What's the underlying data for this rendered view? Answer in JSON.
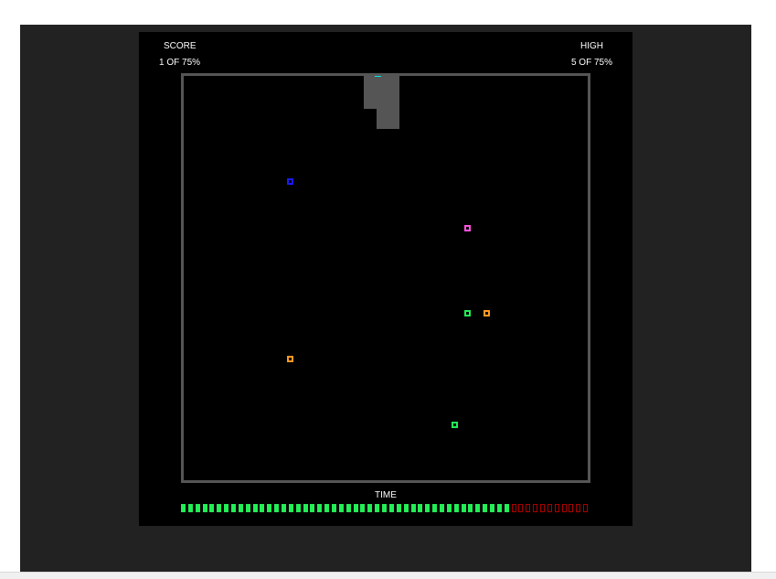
{
  "hud": {
    "score_label": "SCORE",
    "score_value": "1 OF 75%",
    "high_label": "HIGH",
    "high_value": "5 OF 75%",
    "time_label": "TIME"
  },
  "time": {
    "segments_total": 57,
    "segments_remaining": 46,
    "fill_color": "#22ee55",
    "empty_color": "#aa0000"
  },
  "colors": {
    "frame_background": "#222222",
    "game_background": "#000000",
    "border": "#555555",
    "claimed_area": "#555555",
    "hud_text": "#ffffff"
  },
  "entities": {
    "player": {
      "color": "#00e5e5",
      "icon": "player-cursor-icon"
    },
    "enemies": [
      {
        "color": "#1a1aff",
        "icon": "blue-enemy-icon"
      },
      {
        "color": "#ff55dd",
        "icon": "pink-enemy-icon"
      },
      {
        "color": "#22ee55",
        "icon": "green-enemy-icon"
      },
      {
        "color": "#ff9922",
        "icon": "orange-enemy-icon"
      },
      {
        "color": "#ff9922",
        "icon": "orange-enemy-icon"
      },
      {
        "color": "#22ee55",
        "icon": "green-enemy-icon"
      }
    ]
  }
}
